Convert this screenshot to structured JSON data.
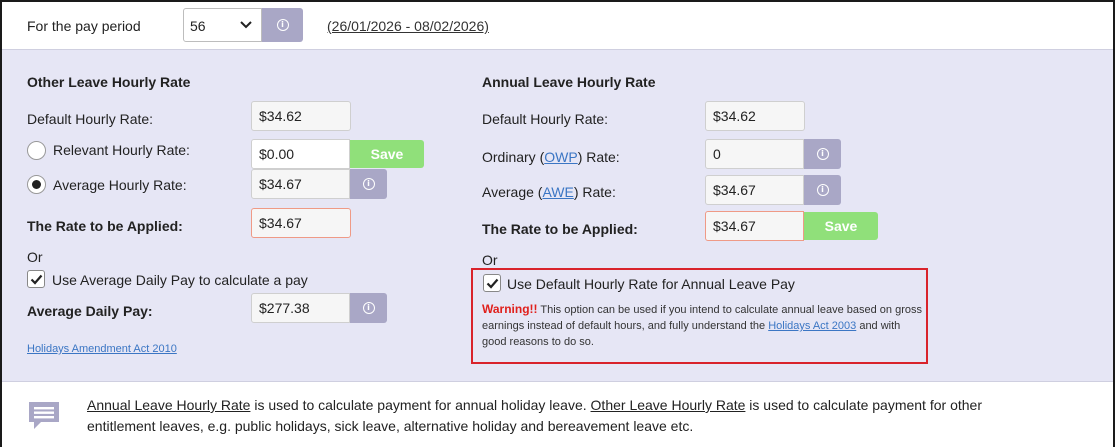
{
  "pay_period": {
    "label": "For the pay period",
    "selected_value": "56",
    "date_range": "(26/01/2026 - 08/02/2026)"
  },
  "other_leave": {
    "heading": "Other Leave Hourly Rate",
    "default_label": "Default Hourly Rate:",
    "default_value": "$34.62",
    "relevant_label": "Relevant Hourly Rate:",
    "relevant_value": "$0.00",
    "save_label": "Save",
    "average_label": "Average Hourly Rate:",
    "average_value": "$34.67",
    "applied_label": "The Rate to be Applied:",
    "applied_value": "$34.67",
    "or_text": "Or",
    "use_daily_label": "Use Average Daily Pay to calculate a pay",
    "daily_label": "Average Daily Pay:",
    "daily_value": "$277.38",
    "act_link": "Holidays Amendment Act 2010"
  },
  "annual_leave": {
    "heading": "Annual Leave Hourly Rate",
    "default_label": "Default Hourly Rate:",
    "default_value": "$34.62",
    "ordinary_prefix": "Ordinary (",
    "ordinary_link": "OWP",
    "ordinary_suffix": ") Rate:",
    "ordinary_value": "0",
    "average_prefix": "Average (",
    "average_link": "AWE",
    "average_suffix": ") Rate:",
    "average_value": "$34.67",
    "applied_label": "The Rate to be Applied:",
    "applied_value": "$34.67",
    "save_label": "Save",
    "or_text": "Or",
    "use_default_label": "Use Default Hourly Rate for Annual Leave Pay",
    "warning_label": "Warning!!",
    "warning_text": " This option can be used if you intend to calculate annual leave based on gross earnings instead of default hours, and fully understand the ",
    "warning_link": "Holidays Act 2003",
    "warning_tail": " and with good reasons to do so."
  },
  "footer": {
    "link1": "Annual Leave Hourly Rate",
    "text1": " is used to calculate payment for annual holiday leave. ",
    "link2": "Other Leave Hourly Rate",
    "text2": " is used to calculate payment for other entitlement leaves, e.g. public holidays, sick leave, alternative holiday and bereavement leave etc."
  },
  "icons": {
    "info": "info-icon",
    "chevron": "chevron-down-icon",
    "comment": "comment-icon",
    "checkmark": "checkmark-icon"
  },
  "colors": {
    "panel_bg": "#e6e6f5",
    "info_button": "#a9a7c6",
    "save_button": "#90e07a",
    "warning_red": "#e0201c",
    "link_blue": "#3b76c4"
  },
  "state": {
    "relevant_rate_selected": false,
    "average_rate_selected": true,
    "use_average_daily_checked": true,
    "use_default_hourly_checked": true
  }
}
